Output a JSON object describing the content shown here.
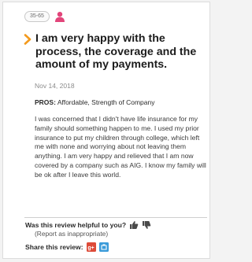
{
  "review": {
    "age_range": "35-65",
    "title": "I am very happy with the process, the coverage and the amount of my payments.",
    "date": "Nov 14, 2018",
    "pros_label": "PROS:",
    "pros_text": "Affordable, Strength of Company",
    "body": "I was concerned that I didn't have life insurance for my family should something happen to me. I used my prior insurance to put my children through college, which left me with none and worrying about not leaving them anything. I am very happy and relieved that I am now covered by a company such as AIG. I know my family will be ok after I leave this world."
  },
  "feedback": {
    "helpful_question": "Was this review helpful to you?",
    "report_link": "(Report as inappropriate)",
    "share_label": "Share this review:"
  },
  "colors": {
    "accent_orange": "#f39a1d",
    "avatar_pink": "#e2457a",
    "google_plus_red": "#dd4b39",
    "share_blue": "#3b9bd9"
  },
  "icons": {
    "avatar": "person-avatar-icon",
    "chevron": "chevron-right-icon",
    "thumbs_up": "thumbs-up-icon",
    "thumbs_down": "thumbs-down-icon",
    "share_google_plus": "google-plus-icon",
    "share_other": "share-icon"
  }
}
